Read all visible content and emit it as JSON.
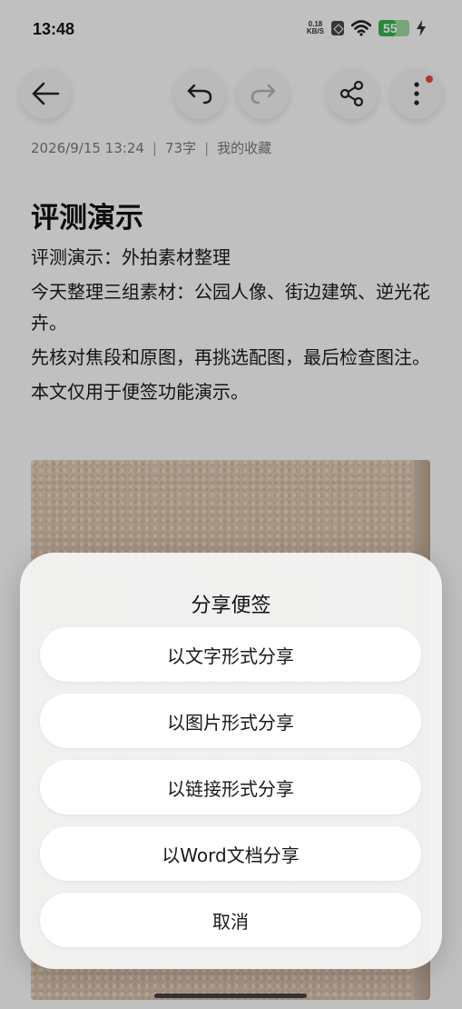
{
  "status_bar": {
    "time": "13:48",
    "net_speed_value": "0.18",
    "net_speed_unit": "KB/S",
    "battery": "55",
    "battery_level": 0.55
  },
  "toolbar": {
    "back_icon": "arrow-left-icon",
    "undo_icon": "undo-icon",
    "redo_icon": "redo-icon",
    "share_icon": "share-icon",
    "more_icon": "more-vertical-icon"
  },
  "note": {
    "date": "2026/9/15 13:24",
    "word_count": "73字",
    "folder": "我的收藏",
    "title": "评测演示",
    "paragraphs": [
      "评测演示：外拍素材整理",
      "今天整理三组素材：公园人像、街边建筑、逆光花卉。",
      "先核对焦段和原图，再挑选配图，最后检查图注。",
      "本文仅用于便签功能演示。"
    ]
  },
  "share_sheet": {
    "title": "分享便签",
    "options": [
      "以文字形式分享",
      "以图片形式分享",
      "以链接形式分享",
      "以Word文档分享"
    ],
    "cancel": "取消"
  },
  "colors": {
    "badge": "#e8443a",
    "battery": "#2fb24a"
  }
}
